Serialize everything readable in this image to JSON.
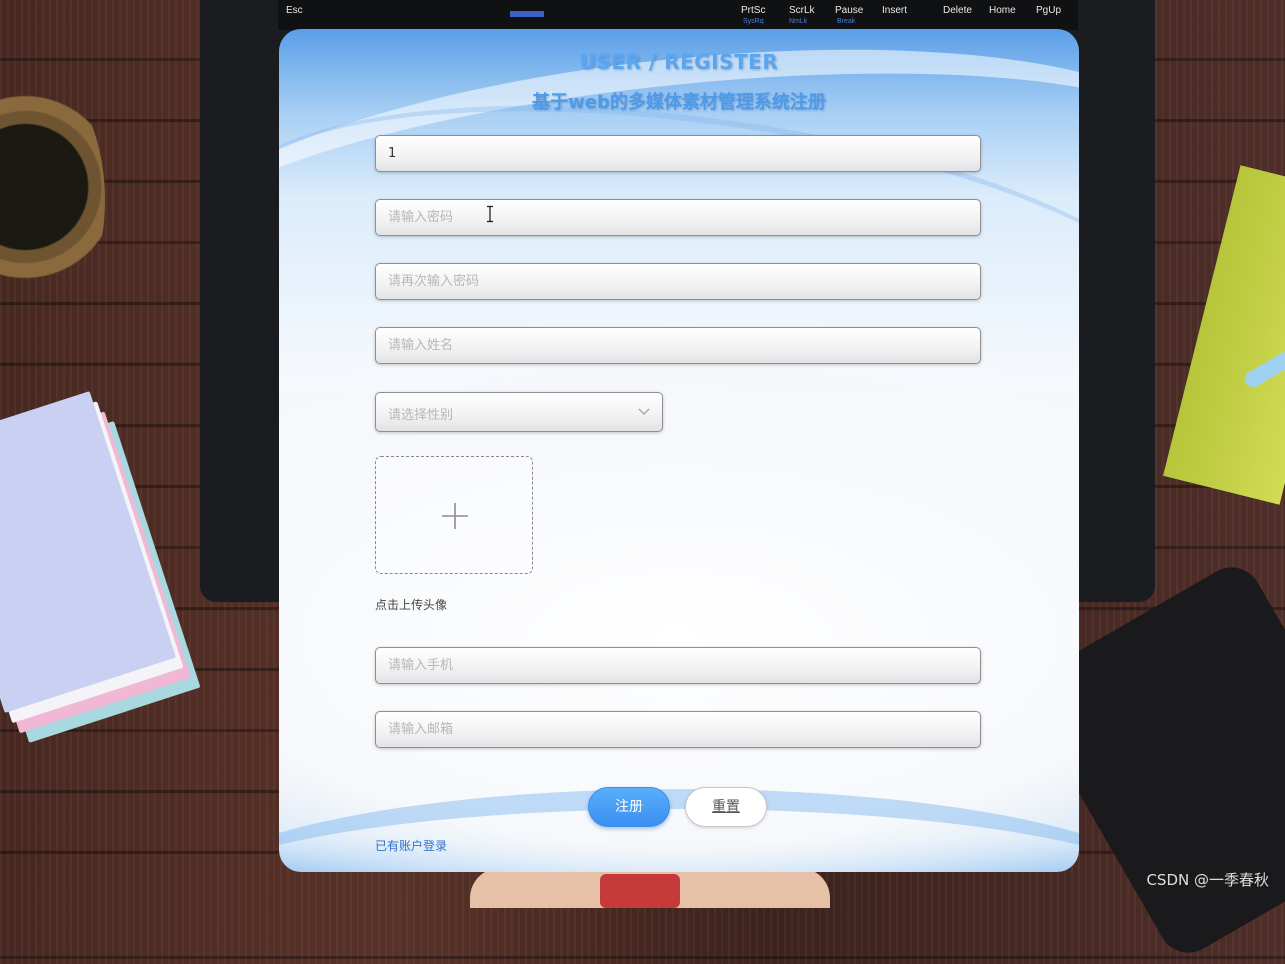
{
  "keyboard": {
    "keys": [
      "Esc",
      "PrtSc",
      "ScrLk",
      "Pause",
      "Insert",
      "Delete",
      "Home",
      "PgUp"
    ],
    "sub_labels": [
      "SysRq",
      "NmLk",
      "Break"
    ]
  },
  "form": {
    "title_en": "USER / REGISTER",
    "title_cn": "基于web的多媒体素材管理系统注册",
    "username_value": "1",
    "password_placeholder": "请输入密码",
    "confirm_password_placeholder": "请再次输入密码",
    "name_placeholder": "请输入姓名",
    "gender_placeholder": "请选择性别",
    "avatar_label": "点击上传头像",
    "phone_placeholder": "请输入手机",
    "email_placeholder": "请输入邮箱",
    "register_label": "注册",
    "reset_label": "重置",
    "login_link": "已有账户登录"
  },
  "watermark": "CSDN @一季春秋",
  "icons": [
    "chevron-down-icon",
    "plus-icon",
    "text-cursor-icon"
  ],
  "colors": {
    "primary": "#3b8ff0",
    "title": "#5aa5ef",
    "link": "#2f6fcf",
    "input_border": "#8f8f93"
  }
}
